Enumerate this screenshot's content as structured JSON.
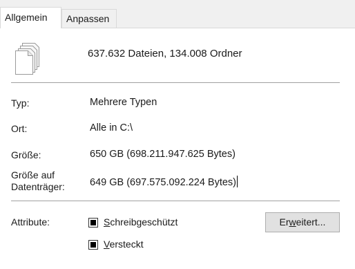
{
  "tabs": [
    {
      "label": "Allgemein",
      "active": true
    },
    {
      "label": "Anpassen",
      "active": false
    }
  ],
  "summary": {
    "icon": "multiple-files-icon",
    "text": "637.632 Dateien, 134.008 Ordner"
  },
  "properties": {
    "type": {
      "label": "Typ:",
      "value": "Mehrere Typen"
    },
    "location": {
      "label": "Ort:",
      "value": "Alle in C:\\"
    },
    "size": {
      "label": "Größe:",
      "value": "650 GB (698.211.947.625 Bytes)"
    },
    "size_on_disk": {
      "label_line1": "Größe auf",
      "label_line2": "Datenträger:",
      "value": "649 GB (697.575.092.224 Bytes)"
    }
  },
  "attributes": {
    "label": "Attribute:",
    "readonly": {
      "label_first": "S",
      "label_rest": "chreibgeschützt",
      "state": "indeterminate"
    },
    "hidden": {
      "label_first": "V",
      "label_rest": "ersteckt",
      "state": "indeterminate"
    },
    "advanced_button": {
      "label_before": "Er",
      "label_accel": "w",
      "label_after": "eitert..."
    }
  }
}
